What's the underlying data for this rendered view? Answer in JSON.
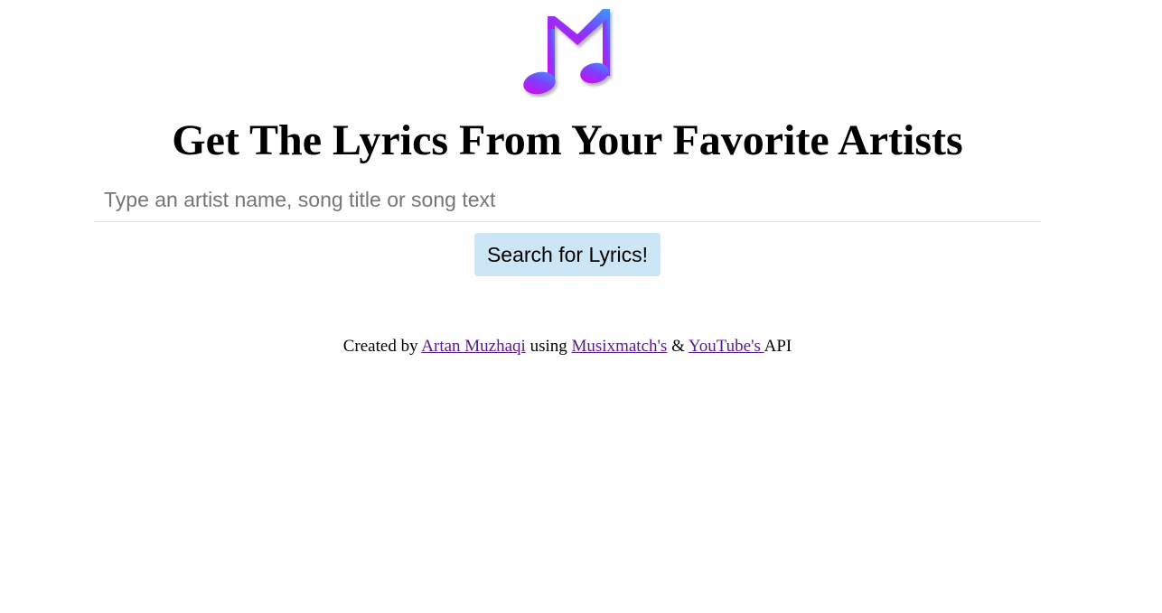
{
  "logo": {
    "icon": "music-note-icon",
    "colors": [
      "#e600e6",
      "#7a40ff",
      "#3d9bff"
    ]
  },
  "headline": "Get The Lyrics From Your Favorite Artists",
  "search": {
    "value": "",
    "placeholder": "Type an artist name, song title or song text",
    "button_label": "Search for Lyrics!"
  },
  "credits": {
    "prefix": "Created by ",
    "author_link": "Artan Muzhaqi",
    "middle": " using ",
    "musixmatch_link": "Musixmatch's",
    "ampersand": " & ",
    "youtube_link": "YouTube's ",
    "suffix": "API"
  },
  "colors": {
    "button_bg": "#cce6f5",
    "link": "#551a8b",
    "input_border": "#e2e2e2"
  }
}
